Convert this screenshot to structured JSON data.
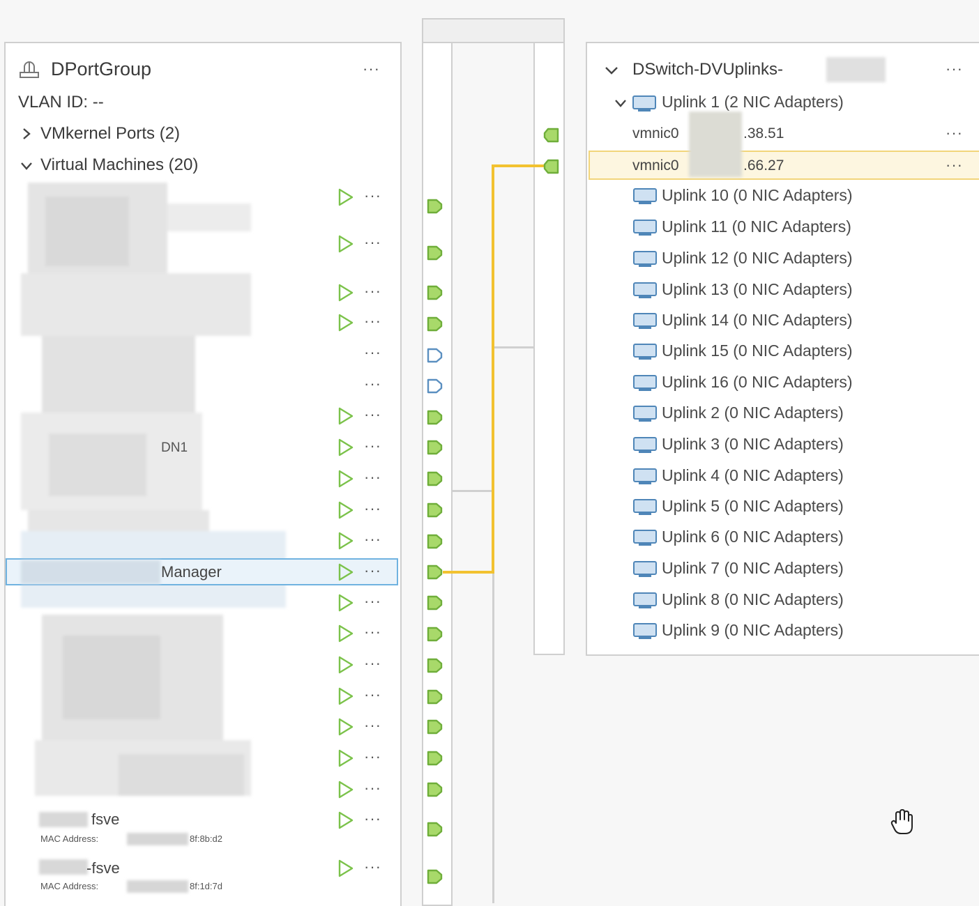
{
  "colors": {
    "accent_green": "#7bc24a",
    "port_green_fill": "#a8d96a",
    "connection_yellow": "#f2c230",
    "selection_blue": "#5aa7d8",
    "highlight_yellow_bg": "#fdf6e0"
  },
  "portgroup": {
    "icon": "portgroup-icon",
    "title": "DPortGroup",
    "vlan": "VLAN ID: --",
    "vmkernel_label": "VMkernel Ports (2)",
    "vm_label": "Virtual Machines (20)",
    "more": "···",
    "vm_names": {
      "dn1": "DN1",
      "manager": "Manager",
      "fsve1": "fsve",
      "fsve2": "-fsve"
    },
    "mac1_label": "MAC Address:",
    "mac1_suffix": "8f:8b:d2",
    "mac2_label": "MAC Address:",
    "mac2_suffix": "8f:1d:7d"
  },
  "uplinks": {
    "title": "DSwitch-DVUplinks-",
    "more": "···",
    "uplink1": "Uplink 1 (2 NIC Adapters)",
    "nic1_prefix": "vmnic0",
    "nic1_suffix": ".38.51",
    "nic2_prefix": "vmnic0",
    "nic2_suffix": ".66.27",
    "items": [
      "Uplink 10 (0 NIC Adapters)",
      "Uplink 11 (0 NIC Adapters)",
      "Uplink 12 (0 NIC Adapters)",
      "Uplink 13 (0 NIC Adapters)",
      "Uplink 14 (0 NIC Adapters)",
      "Uplink 15 (0 NIC Adapters)",
      "Uplink 16 (0 NIC Adapters)",
      "Uplink 2 (0 NIC Adapters)",
      "Uplink 3 (0 NIC Adapters)",
      "Uplink 4 (0 NIC Adapters)",
      "Uplink 5 (0 NIC Adapters)",
      "Uplink 6 (0 NIC Adapters)",
      "Uplink 7 (0 NIC Adapters)",
      "Uplink 8 (0 NIC Adapters)",
      "Uplink 9 (0 NIC Adapters)"
    ]
  },
  "cursor": "hand-cursor-icon"
}
